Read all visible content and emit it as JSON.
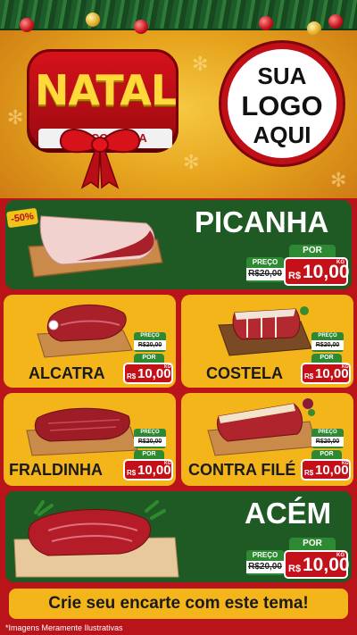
{
  "header": {
    "title_main": "NATAL",
    "title_sub": "DA ECONOMIA",
    "logo_line1": "SUA",
    "logo_line2": "LOGO",
    "logo_line3": "AQUI"
  },
  "featured": {
    "badge": "-50%",
    "name": "PICANHA",
    "por_label": "POR",
    "preco_label": "PREÇO",
    "old_price": "R$20,00",
    "currency": "R$",
    "price": "10,00",
    "unit": "KG"
  },
  "products": [
    {
      "name": "ALCATRA",
      "preco_label": "PREÇO",
      "old_price": "R$20,00",
      "por_label": "POR",
      "currency": "R$",
      "price": "10,00",
      "unit": "KG"
    },
    {
      "name": "COSTELA",
      "preco_label": "PREÇO",
      "old_price": "R$20,00",
      "por_label": "POR",
      "currency": "R$",
      "price": "10,00",
      "unit": "KG"
    },
    {
      "name": "FRALDINHA",
      "preco_label": "PREÇO",
      "old_price": "R$20,00",
      "por_label": "POR",
      "currency": "R$",
      "price": "10,00",
      "unit": "KG"
    },
    {
      "name": "CONTRA FILÉ",
      "preco_label": "PREÇO",
      "old_price": "R$20,00",
      "por_label": "POR",
      "currency": "R$",
      "price": "10,00",
      "unit": "KG"
    }
  ],
  "bottom_featured": {
    "name": "ACÉM",
    "por_label": "POR",
    "preco_label": "PREÇO",
    "old_price": "R$20,00",
    "currency": "R$",
    "price": "10,00",
    "unit": "KG"
  },
  "footer": {
    "cta": "Crie seu encarte com este tema!",
    "disclaimer": "*Imagens Meramente Ilustrativas"
  },
  "colors": {
    "red": "#c41018",
    "green_card": "#1f5a24",
    "yellow_card": "#f4b51a",
    "tag_green": "#2e8a32"
  }
}
